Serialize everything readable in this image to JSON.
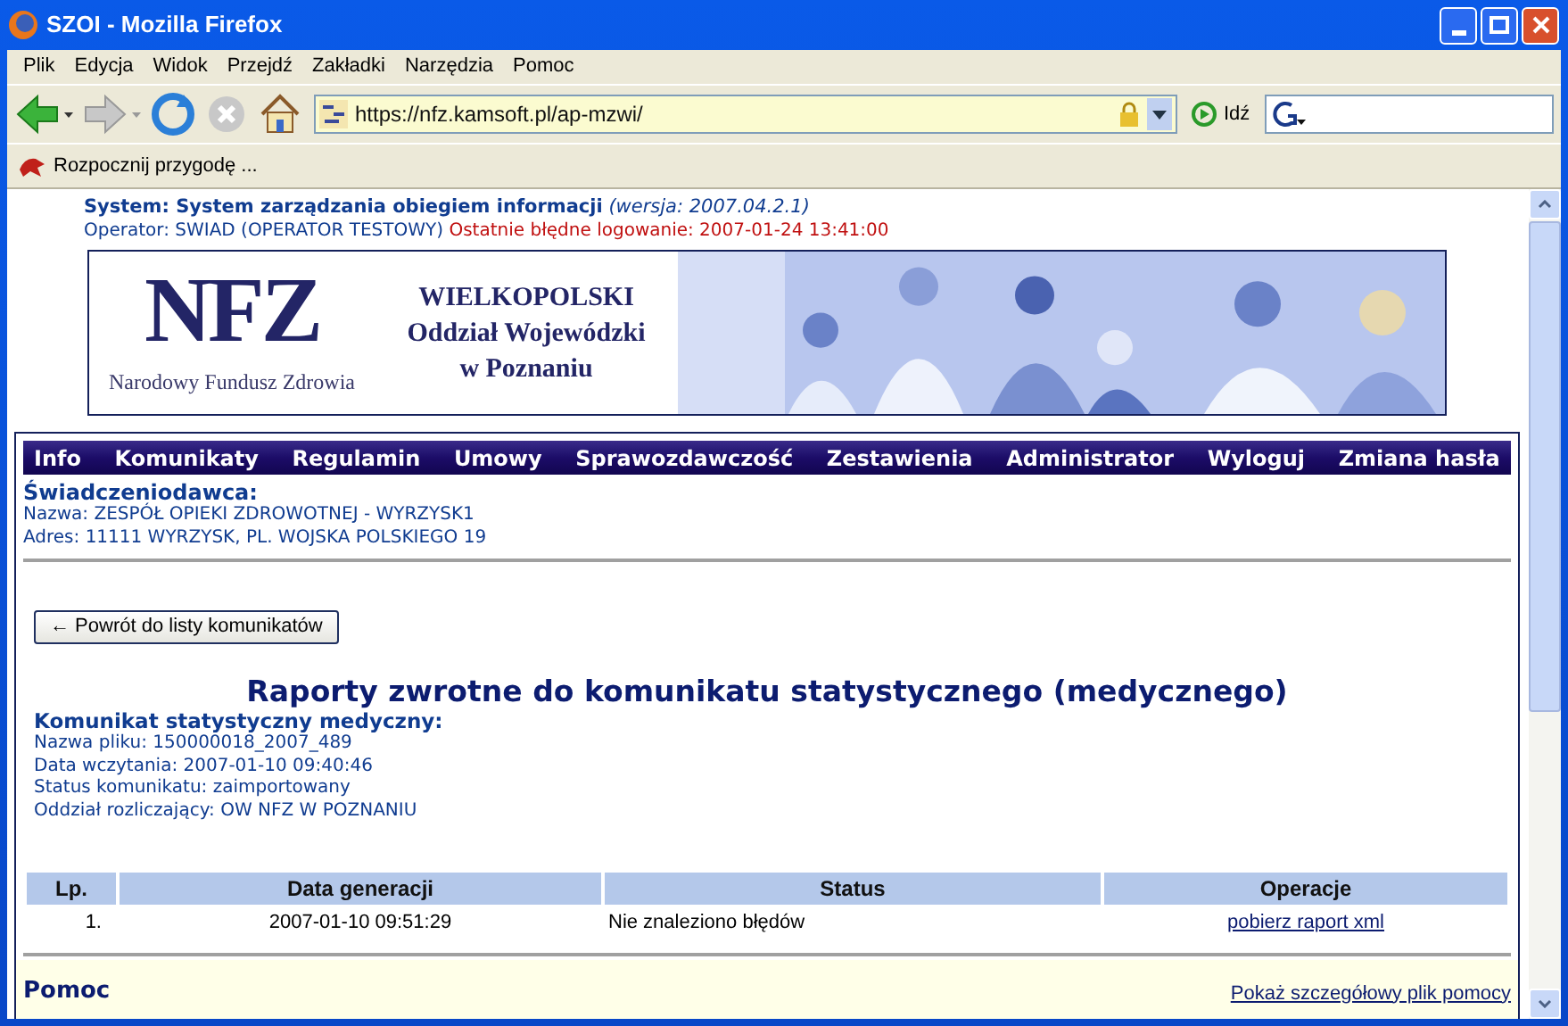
{
  "window": {
    "title": "SZOI - Mozilla Firefox"
  },
  "menu": [
    "Plik",
    "Edycja",
    "Widok",
    "Przejdź",
    "Zakładki",
    "Narzędzia",
    "Pomoc"
  ],
  "toolbar": {
    "url": "https://nfz.kamsoft.pl/ap-mzwi/",
    "go_label": "Idź"
  },
  "bookmarks": [
    {
      "label": "Rozpocznij przygodę ..."
    }
  ],
  "header": {
    "system_label": "System: System zarządzania obiegiem informacji",
    "version": "(wersja: 2007.04.2.1)",
    "operator": "Operator: SWIAD (OPERATOR TESTOWY)",
    "last_failed_login": "Ostatnie błędne logowanie: 2007-01-24 13:41:00"
  },
  "banner": {
    "logo": "NFZ",
    "logo_caption": "Narodowy Fundusz Zdrowia",
    "branch_lines": [
      "WIELKOPOLSKI",
      "Oddział Wojewódzki",
      "w Poznaniu"
    ]
  },
  "nav": [
    "Info",
    "Komunikaty",
    "Regulamin",
    "Umowy",
    "Sprawozdawczość",
    "Zestawienia",
    "Administrator",
    "Wyloguj",
    "Zmiana hasła"
  ],
  "provider": {
    "heading": "Świadczeniodawca:",
    "lines": [
      "Nazwa: ZESPÓŁ OPIEKI ZDROWOTNEJ - WYRZYSK1",
      "Adres: 11111 WYRZYSK, PL. WOJSKA POLSKIEGO 19"
    ]
  },
  "back_button": "← Powrót do listy komunikatów",
  "page_title": "Raporty zwrotne do komunikatu statystycznego (medycznego)",
  "message": {
    "heading": "Komunikat statystyczny medyczny:",
    "lines": [
      "Nazwa pliku: 150000018_2007_489",
      "Data wczytania: 2007-01-10 09:40:46",
      "Status komunikatu: zaimportowany",
      "Oddział rozliczający: OW NFZ W POZNANIU"
    ]
  },
  "table": {
    "columns": [
      "Lp.",
      "Data generacji",
      "Status",
      "Operacje"
    ],
    "rows": [
      {
        "lp": "1.",
        "date": "2007-01-10 09:51:29",
        "status": "Nie znaleziono błędów",
        "action": "pobierz raport xml"
      }
    ]
  },
  "help": {
    "title": "Pomoc",
    "link": "Pokaż szczegółowy plik pomocy"
  }
}
